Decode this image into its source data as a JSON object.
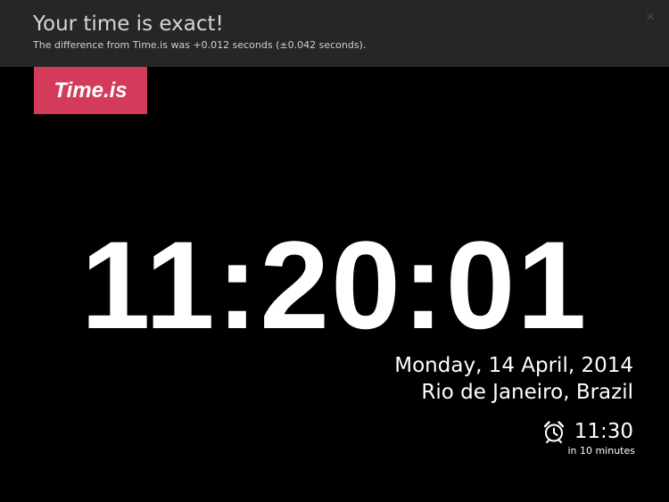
{
  "banner": {
    "title": "Your time is exact!",
    "subtitle": "The difference from Time.is was +0.012 seconds (±0.042 seconds).",
    "close_label": "×"
  },
  "logo": {
    "text": "Time.is",
    "color": "#d43a5a"
  },
  "clock": {
    "time": "11:20:01"
  },
  "info": {
    "date": "Monday, 14 April, 2014",
    "location": "Rio de Janeiro, Brazil"
  },
  "alarm": {
    "icon": "alarm-clock-icon",
    "time": "11:30",
    "note": "in 10 minutes"
  }
}
